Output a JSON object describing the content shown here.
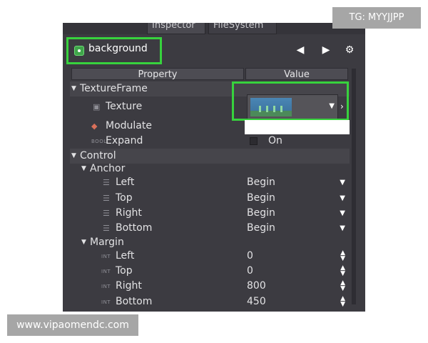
{
  "tabs": [
    {
      "label": "Inspector"
    },
    {
      "label": "FileSystem"
    }
  ],
  "toolbar": {
    "node_name": "background",
    "back_icon": "triangle-left",
    "forward_icon": "triangle-right",
    "settings_icon": "gear"
  },
  "columns": {
    "property": "Property",
    "value": "Value"
  },
  "sections": {
    "texture_frame": "TextureFrame",
    "control": "Control",
    "anchor": "Anchor",
    "margin": "Margin"
  },
  "texture_frame": {
    "texture_label": "Texture",
    "modulate_label": "Modulate",
    "modulate_color": "#ffffff",
    "expand_label": "Expand",
    "expand_type": "BOOL",
    "expand_value": "On"
  },
  "anchor": [
    {
      "label": "Left",
      "value": "Begin"
    },
    {
      "label": "Top",
      "value": "Begin"
    },
    {
      "label": "Right",
      "value": "Begin"
    },
    {
      "label": "Bottom",
      "value": "Begin"
    }
  ],
  "margin": {
    "type_tag": "INT",
    "items": [
      {
        "label": "Left",
        "value": "0"
      },
      {
        "label": "Top",
        "value": "0"
      },
      {
        "label": "Right",
        "value": "800"
      },
      {
        "label": "Bottom",
        "value": "450"
      }
    ]
  },
  "overlay": {
    "tag": "TG: MYYJJPP",
    "watermark": "www.vipaomendc.com"
  },
  "colors": {
    "panel_bg": "#3c3b41",
    "highlight": "#37d23d",
    "text": "#e2e2e4"
  }
}
